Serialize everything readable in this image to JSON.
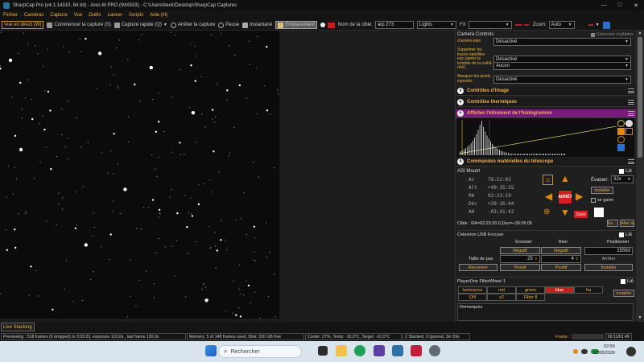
{
  "window": {
    "title": "SharpCap Pro (v4.1.14310, 64 bit) - Ares-M PRO (IMX533) - C:\\Users\\beck\\Desktop\\SharpCap Captures",
    "controls": [
      "—",
      "□",
      "✕"
    ]
  },
  "menu": [
    "Fichier",
    "Caméras",
    "Capture",
    "Vue",
    "Outils",
    "Lancer",
    "Scripts",
    "Aide (H)"
  ],
  "toolbar": {
    "live": "Vue en direct (W)",
    "start_capture": "Commencer la capture (S)",
    "quick_capture": "Capture rapide (Q)",
    "stop_capture": "Arrêter la capture",
    "pause": "Pause",
    "snapshot": "Instantané",
    "placement": "Emplacement",
    "target_label": "Nom de la cible:",
    "target_value": "arp 273",
    "frame_type": "Lights",
    "fx_label": "FX",
    "fx_value": "",
    "zoom_label": "Zoom:",
    "zoom_value": "Auto"
  },
  "panel": {
    "header": "Camera Controls",
    "collapse_label": "Colonnes multiples",
    "camera_rows": [
      {
        "label": "d'arrière-plan",
        "value": "Désactivé"
      },
      {
        "label": "Supprimer les traces satellites exp (après la tombée de la nuit/à réel)",
        "value": "Désactivé"
      },
      {
        "label": "",
        "value": "Aucun"
      },
      {
        "label": "Masquer les pixels exposés",
        "value": "Désactivé"
      }
    ],
    "sections": {
      "image": "Contrôles d'image",
      "thermal": "Contrôles thermiques",
      "histogram": "Afficher l'étirement de l'histogramme",
      "telescope": "Commandes matérielles du télescope"
    },
    "mount": {
      "name": "ASI Mount",
      "linked": "Lié",
      "coords": [
        {
          "k": "Az",
          "v": "78:52:03"
        },
        {
          "k": "Alt",
          "v": "+49:35:55"
        },
        {
          "k": "RA",
          "v": "02:23:19"
        },
        {
          "k": "Déc",
          "v": "+39:26:04"
        },
        {
          "k": "AH",
          "v": "-03:41:42"
        }
      ],
      "stop_label": "ARRÊT",
      "rate_label": "Évaluer:",
      "rate_value": "32x",
      "install": "Installer",
      "park": "se garer",
      "track": "Suivi",
      "target": "Cible : RA=02:23:20.0,Dec=+39:26:05",
      "goto": "Aller à"
    },
    "focuser": {
      "name": "Celestron USB Focuser",
      "linked": "Lié",
      "coarse": "Grossier",
      "fine": "Bien",
      "position_label": "Positionner",
      "position": "15563",
      "neg1": "Négatif",
      "neg2": "Négatif",
      "step_label": "Taille de pas",
      "step1": "25",
      "step2": "4",
      "stop": "Arrêter",
      "recenter": "Recentrer",
      "pos1": "Positif",
      "pos2": "Positif",
      "install": "Installer"
    },
    "filterwheel": {
      "name": "PlayerOne FilterWheel 1",
      "linked": "Lié",
      "filters": [
        "luminance",
        "red",
        "green",
        "blue",
        "ha",
        "OIII",
        "s2",
        "Filter 8"
      ],
      "selected": "blue",
      "install": "Installer"
    },
    "remarks_label": "Remarques"
  },
  "status": {
    "live_stacking": "Live Stacking",
    "previewing": "Previewing : 518 frames (0 dropped) in 3:59:23, exposure 120,0s , last frame 120,0s",
    "memory": "Memory: 5 of 148 frames used, Disk: 220 GB free",
    "cooler": "Cooler: 27%, Temp: -10,0°C, Target: -10,0°C",
    "stacked": "2 Stacked, 0 Ignored, 3m 59s",
    "frame_label": "Frame :",
    "elapsed": "00:11/01:49"
  },
  "taskbar": {
    "search": "Rechercher",
    "time": "02:55",
    "date": "12/08/2026"
  },
  "colors": {
    "accent": "#f0b040",
    "histogram_header": "#7a1a7a",
    "stop_red": "#d02020"
  }
}
